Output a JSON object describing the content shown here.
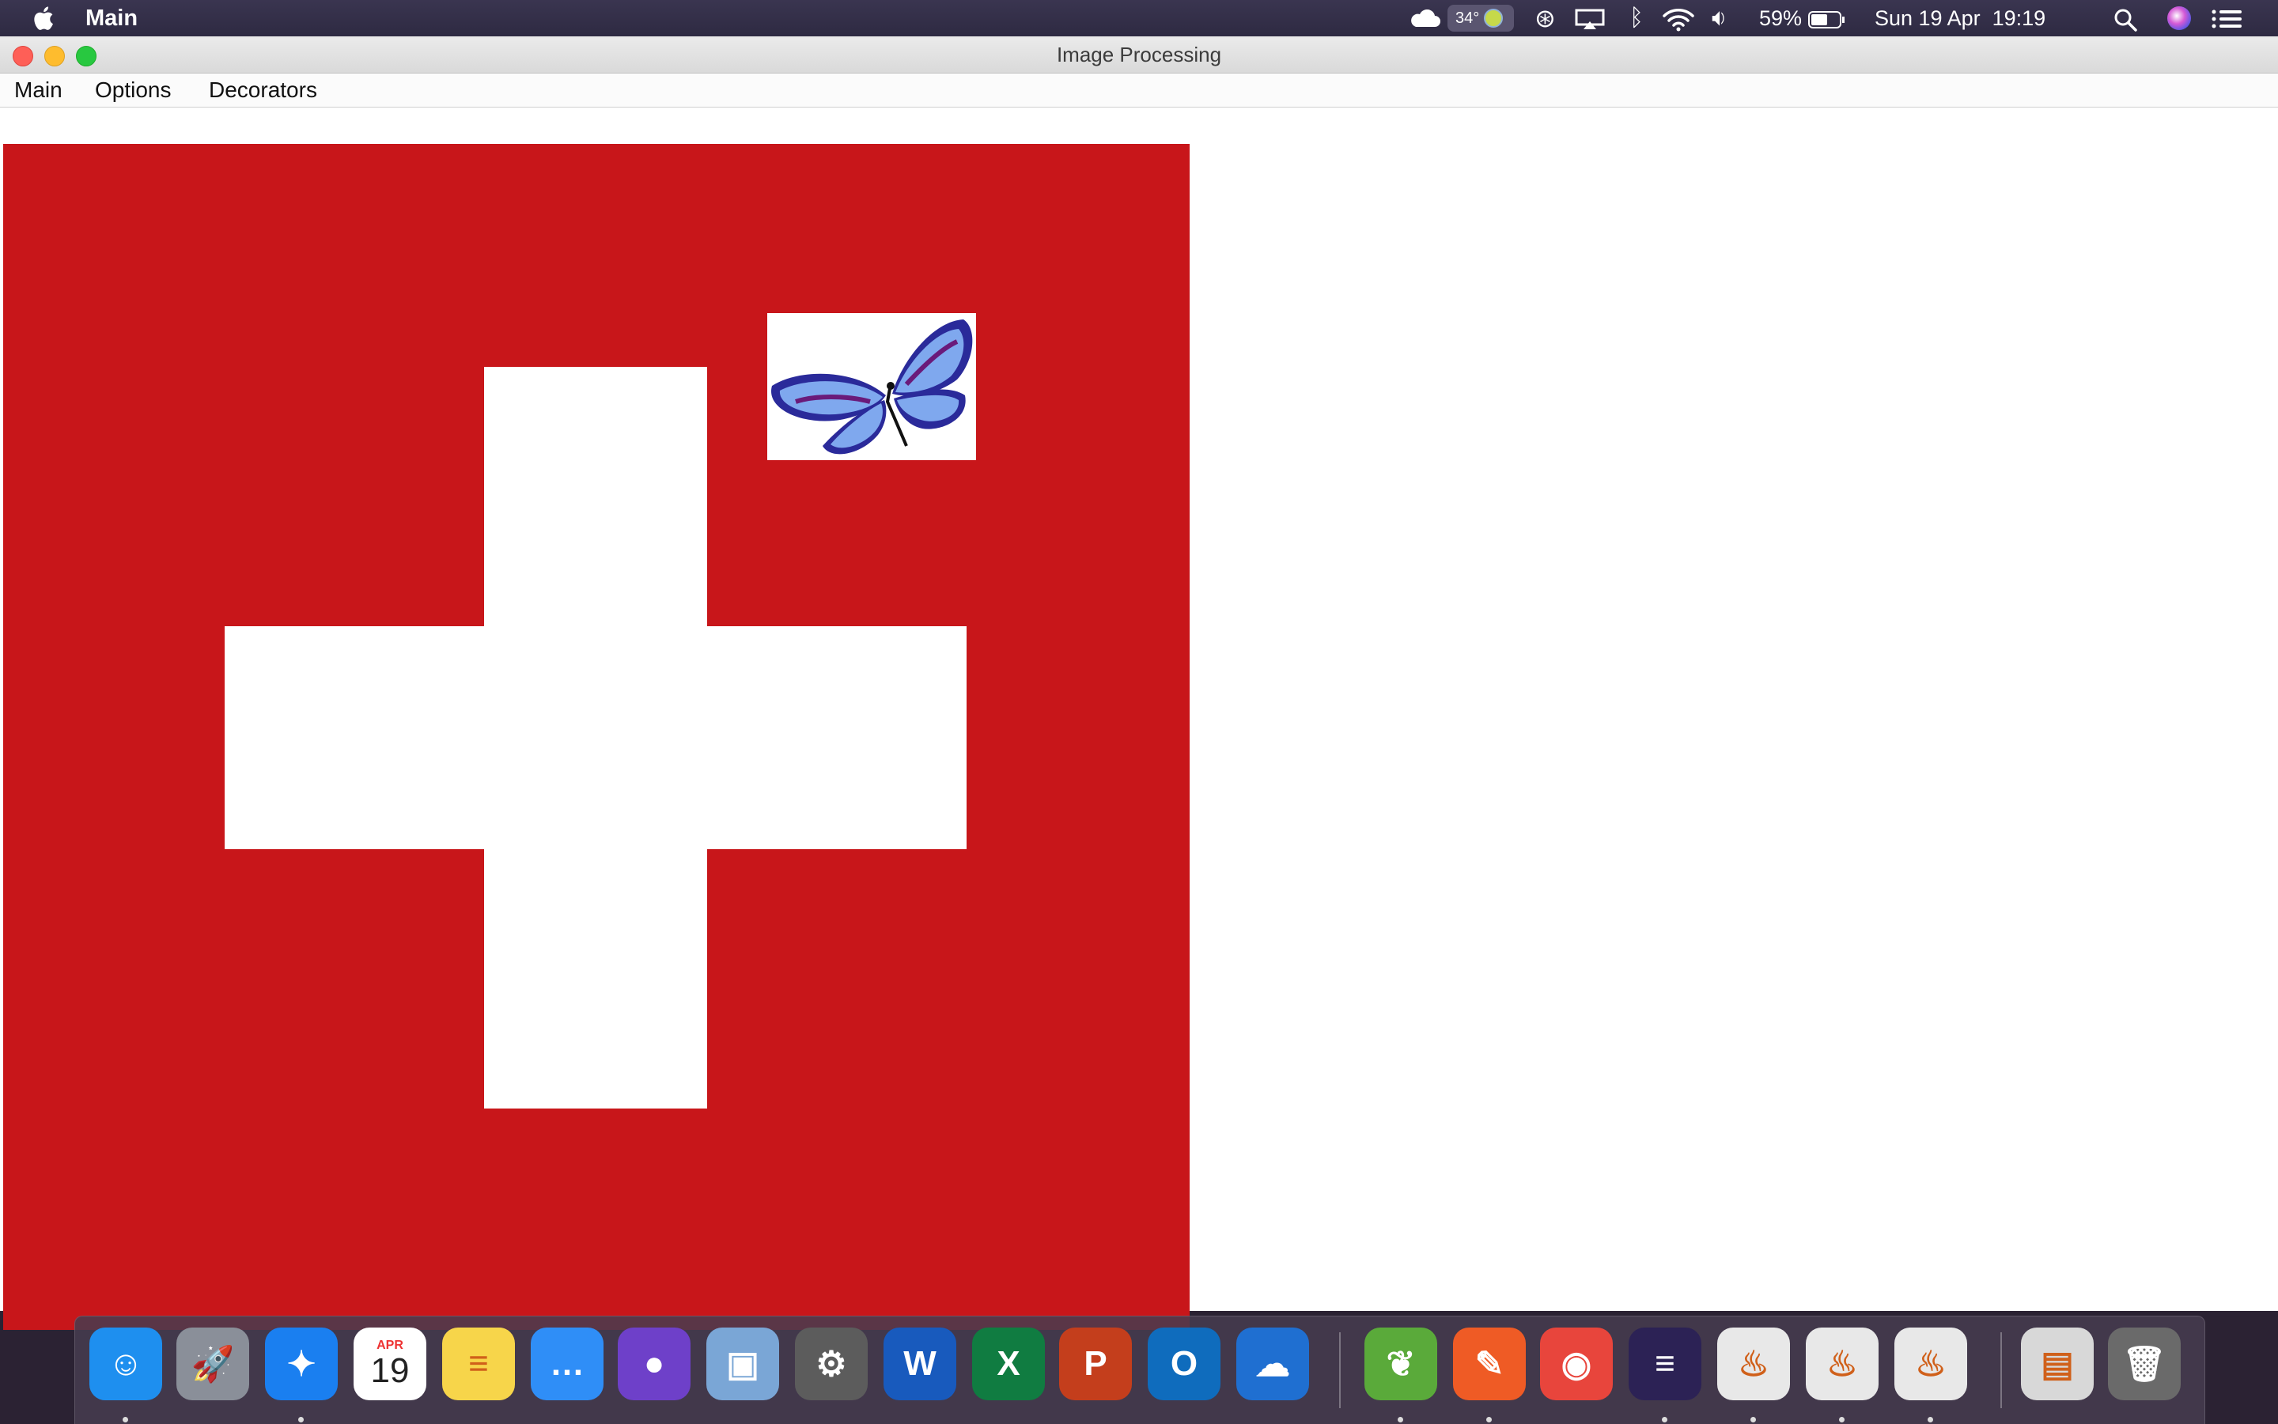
{
  "menubar": {
    "app_name": "Main",
    "weather_temp": "34°",
    "battery": "59%",
    "datetime": "Sun 19 Apr  19:19"
  },
  "window": {
    "title": "Image Processing",
    "menus": [
      "Main",
      "Options",
      "Decorators"
    ]
  },
  "canvas": {
    "flag_color": "#c8161a",
    "cross_color": "#ffffff"
  },
  "dock": {
    "calendar_month": "APR",
    "calendar_day": "19",
    "items": [
      {
        "name": "finder-icon",
        "glyph": "☺",
        "color": "#1e8fef"
      },
      {
        "name": "launchpad-icon",
        "glyph": "🚀",
        "color": "#8a8f99"
      },
      {
        "name": "safari-icon",
        "glyph": "✦",
        "color": "#1a7ff0"
      },
      {
        "name": "calendar-icon",
        "glyph": "",
        "color": "#ffffff"
      },
      {
        "name": "notes-icon",
        "glyph": "≡",
        "color": "#f7d54a"
      },
      {
        "name": "messages-icon",
        "glyph": "…",
        "color": "#2f8ef7"
      },
      {
        "name": "github-desktop-icon",
        "glyph": "●",
        "color": "#6e40c9"
      },
      {
        "name": "preview-icon",
        "glyph": "▣",
        "color": "#7aa6d6"
      },
      {
        "name": "system-preferences-icon",
        "glyph": "⚙",
        "color": "#5c5c5c"
      },
      {
        "name": "word-icon",
        "glyph": "W",
        "color": "#185abd"
      },
      {
        "name": "excel-icon",
        "glyph": "X",
        "color": "#107c41"
      },
      {
        "name": "powerpoint-icon",
        "glyph": "P",
        "color": "#c43e1c"
      },
      {
        "name": "outlook-icon",
        "glyph": "O",
        "color": "#0f6cbd"
      },
      {
        "name": "onedrive-icon",
        "glyph": "☁",
        "color": "#1f6fd1"
      },
      {
        "name": "spring-tool-suite-icon",
        "glyph": "❦",
        "color": "#5aaa3a"
      },
      {
        "name": "postman-icon",
        "glyph": "✎",
        "color": "#ef5b25"
      },
      {
        "name": "chrome-icon",
        "glyph": "◉",
        "color": "#e8453c"
      },
      {
        "name": "eclipse-icon",
        "glyph": "≡",
        "color": "#2c2255"
      },
      {
        "name": "java-app-icon-1",
        "glyph": "♨",
        "color": "#e8e8e8"
      },
      {
        "name": "java-app-icon-2",
        "glyph": "♨",
        "color": "#e8e8e8"
      },
      {
        "name": "java-app-icon-3",
        "glyph": "♨",
        "color": "#e8e8e8"
      },
      {
        "name": "documents-stack-icon",
        "glyph": "▤",
        "color": "#d8d8d8"
      },
      {
        "name": "trash-icon",
        "glyph": "🗑",
        "color": "#6a6a6a"
      }
    ]
  }
}
